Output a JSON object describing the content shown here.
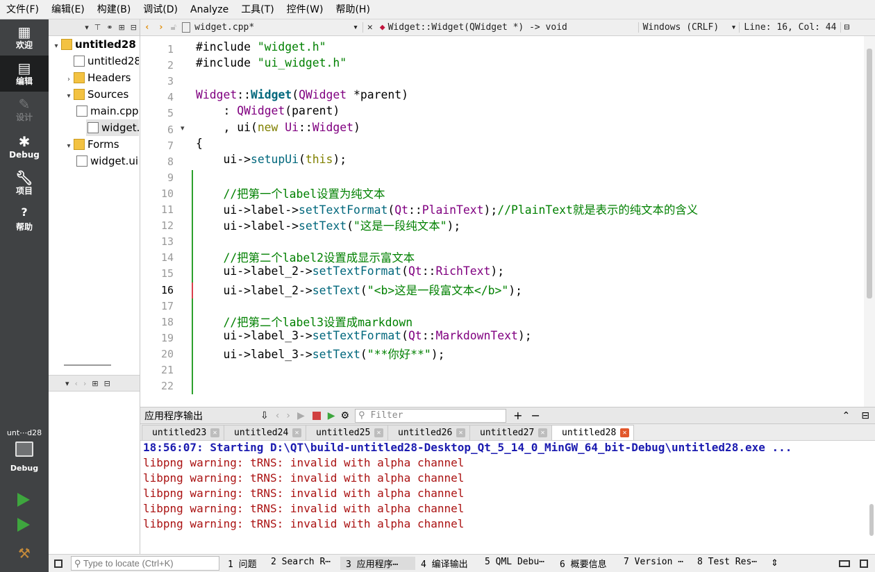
{
  "menu": [
    "文件(F)",
    "编辑(E)",
    "构建(B)",
    "调试(D)",
    "Analyze",
    "工具(T)",
    "控件(W)",
    "帮助(H)"
  ],
  "modes": [
    {
      "label": "欢迎",
      "icon": "grid-icon"
    },
    {
      "label": "编辑",
      "icon": "edit-icon"
    },
    {
      "label": "设计",
      "icon": "pencil-icon"
    },
    {
      "label": "Debug",
      "icon": "bug-icon"
    },
    {
      "label": "项目",
      "icon": "wrench-icon"
    },
    {
      "label": "帮助",
      "icon": "help-icon"
    }
  ],
  "kit": {
    "project": "unt⋯d28",
    "mode": "Debug"
  },
  "project_tree": [
    {
      "label": "untitled28",
      "level": 0,
      "arrow": "▾",
      "icon": "project-icon",
      "bold": true
    },
    {
      "label": "untitled28",
      "level": 1,
      "arrow": "",
      "icon": "pro-file-icon"
    },
    {
      "label": "Headers",
      "level": 1,
      "arrow": "›",
      "icon": "folder-icon"
    },
    {
      "label": "Sources",
      "level": 1,
      "arrow": "▾",
      "icon": "folder-icon"
    },
    {
      "label": "main.cpp",
      "level": 2,
      "arrow": "",
      "icon": "file-icon"
    },
    {
      "label": "widget.cpp",
      "level": 2,
      "arrow": "",
      "icon": "file-icon",
      "selected": true
    },
    {
      "label": "Forms",
      "level": 1,
      "arrow": "▾",
      "icon": "folder-icon"
    },
    {
      "label": "widget.ui",
      "level": 2,
      "arrow": "",
      "icon": "ui-file-icon"
    }
  ],
  "editor": {
    "filename": "widget.cpp*",
    "symbol": "Widget::Widget(QWidget *) -> void",
    "encoding": "Windows (CRLF)",
    "position": "Line: 16, Col: 44",
    "current_line": 16
  },
  "code_lines": [
    [
      [
        "p",
        "#include "
      ],
      [
        "s",
        "\"widget.h\""
      ]
    ],
    [
      [
        "p",
        "#include "
      ],
      [
        "s",
        "\"ui_widget.h\""
      ]
    ],
    [],
    [
      [
        "t",
        "Widget"
      ],
      [
        "p",
        "::"
      ],
      [
        "b",
        "Widget"
      ],
      [
        "p",
        "("
      ],
      [
        "t",
        "QWidget"
      ],
      [
        "p",
        " *parent)"
      ]
    ],
    [
      [
        "p",
        "    : "
      ],
      [
        "t",
        "QWidget"
      ],
      [
        "p",
        "(parent)"
      ]
    ],
    [
      [
        "p",
        "    , ui("
      ],
      [
        "k",
        "new "
      ],
      [
        "t",
        "Ui"
      ],
      [
        "p",
        "::"
      ],
      [
        "t",
        "Widget"
      ],
      [
        "p",
        ")"
      ]
    ],
    [
      [
        "p",
        "{"
      ]
    ],
    [
      [
        "p",
        "    ui->"
      ],
      [
        "f",
        "setupUi"
      ],
      [
        "p",
        "("
      ],
      [
        "k",
        "this"
      ],
      [
        "p",
        ");"
      ]
    ],
    [],
    [
      [
        "c",
        "    //把第一个label设置为纯文本"
      ]
    ],
    [
      [
        "p",
        "    ui->label->"
      ],
      [
        "f",
        "setTextFormat"
      ],
      [
        "p",
        "("
      ],
      [
        "t",
        "Qt"
      ],
      [
        "p",
        "::"
      ],
      [
        "t",
        "PlainText"
      ],
      [
        "p",
        ");"
      ],
      [
        "c",
        "//PlainText就是表示的纯文本的含义"
      ]
    ],
    [
      [
        "p",
        "    ui->label->"
      ],
      [
        "f",
        "setText"
      ],
      [
        "p",
        "("
      ],
      [
        "s",
        "\"这是一段纯文本\""
      ],
      [
        "p",
        ");"
      ]
    ],
    [],
    [
      [
        "c",
        "    //把第二个label2设置成显示富文本"
      ]
    ],
    [
      [
        "p",
        "    ui->label_2->"
      ],
      [
        "f",
        "setTextFormat"
      ],
      [
        "p",
        "("
      ],
      [
        "t",
        "Qt"
      ],
      [
        "p",
        "::"
      ],
      [
        "t",
        "RichText"
      ],
      [
        "p",
        ");"
      ]
    ],
    [
      [
        "p",
        "    ui->label_2->"
      ],
      [
        "f",
        "setText"
      ],
      [
        "p",
        "("
      ],
      [
        "s",
        "\"<b>这是一段富文本</b>\""
      ],
      [
        "p",
        ");"
      ]
    ],
    [],
    [
      [
        "c",
        "    //把第二个label3设置成markdown"
      ]
    ],
    [
      [
        "p",
        "    ui->label_3->"
      ],
      [
        "f",
        "setTextFormat"
      ],
      [
        "p",
        "("
      ],
      [
        "t",
        "Qt"
      ],
      [
        "p",
        "::"
      ],
      [
        "t",
        "MarkdownText"
      ],
      [
        "p",
        ");"
      ]
    ],
    [
      [
        "p",
        "    ui->label_3->"
      ],
      [
        "f",
        "setText"
      ],
      [
        "p",
        "("
      ],
      [
        "s",
        "\"**你好**\""
      ],
      [
        "p",
        ");"
      ]
    ],
    [],
    []
  ],
  "output": {
    "title": "应用程序输出",
    "filter_placeholder": "Filter",
    "tabs": [
      "untitled23",
      "untitled24",
      "untitled25",
      "untitled26",
      "untitled27",
      "untitled28"
    ],
    "active_tab": 5,
    "lines": [
      {
        "text": "18:56:07: Starting D:\\QT\\build-untitled28-Desktop_Qt_5_14_0_MinGW_64_bit-Debug\\untitled28.exe ...",
        "kind": "start"
      },
      {
        "text": "libpng warning: tRNS: invalid with alpha channel",
        "kind": "warn"
      },
      {
        "text": "libpng warning: tRNS: invalid with alpha channel",
        "kind": "warn"
      },
      {
        "text": "libpng warning: tRNS: invalid with alpha channel",
        "kind": "warn"
      },
      {
        "text": "libpng warning: tRNS: invalid with alpha channel",
        "kind": "warn"
      },
      {
        "text": "libpng warning: tRNS: invalid with alpha channel",
        "kind": "warn"
      }
    ]
  },
  "statusbar": {
    "locate_placeholder": "Type to locate (Ctrl+K)",
    "panes": [
      "1 问题",
      "2 Search R⋯",
      "3 应用程序⋯",
      "4 编译输出",
      "5 QML Debu⋯",
      "6 概要信息",
      "7 Version ⋯",
      "8 Test Res⋯"
    ]
  },
  "colors": {
    "sidebar": "#404244",
    "start_text": "#1b1bb0",
    "warn_text": "#aa1111",
    "modified_marker": "#2ca02c",
    "current_line_marker": "#d9404b"
  }
}
